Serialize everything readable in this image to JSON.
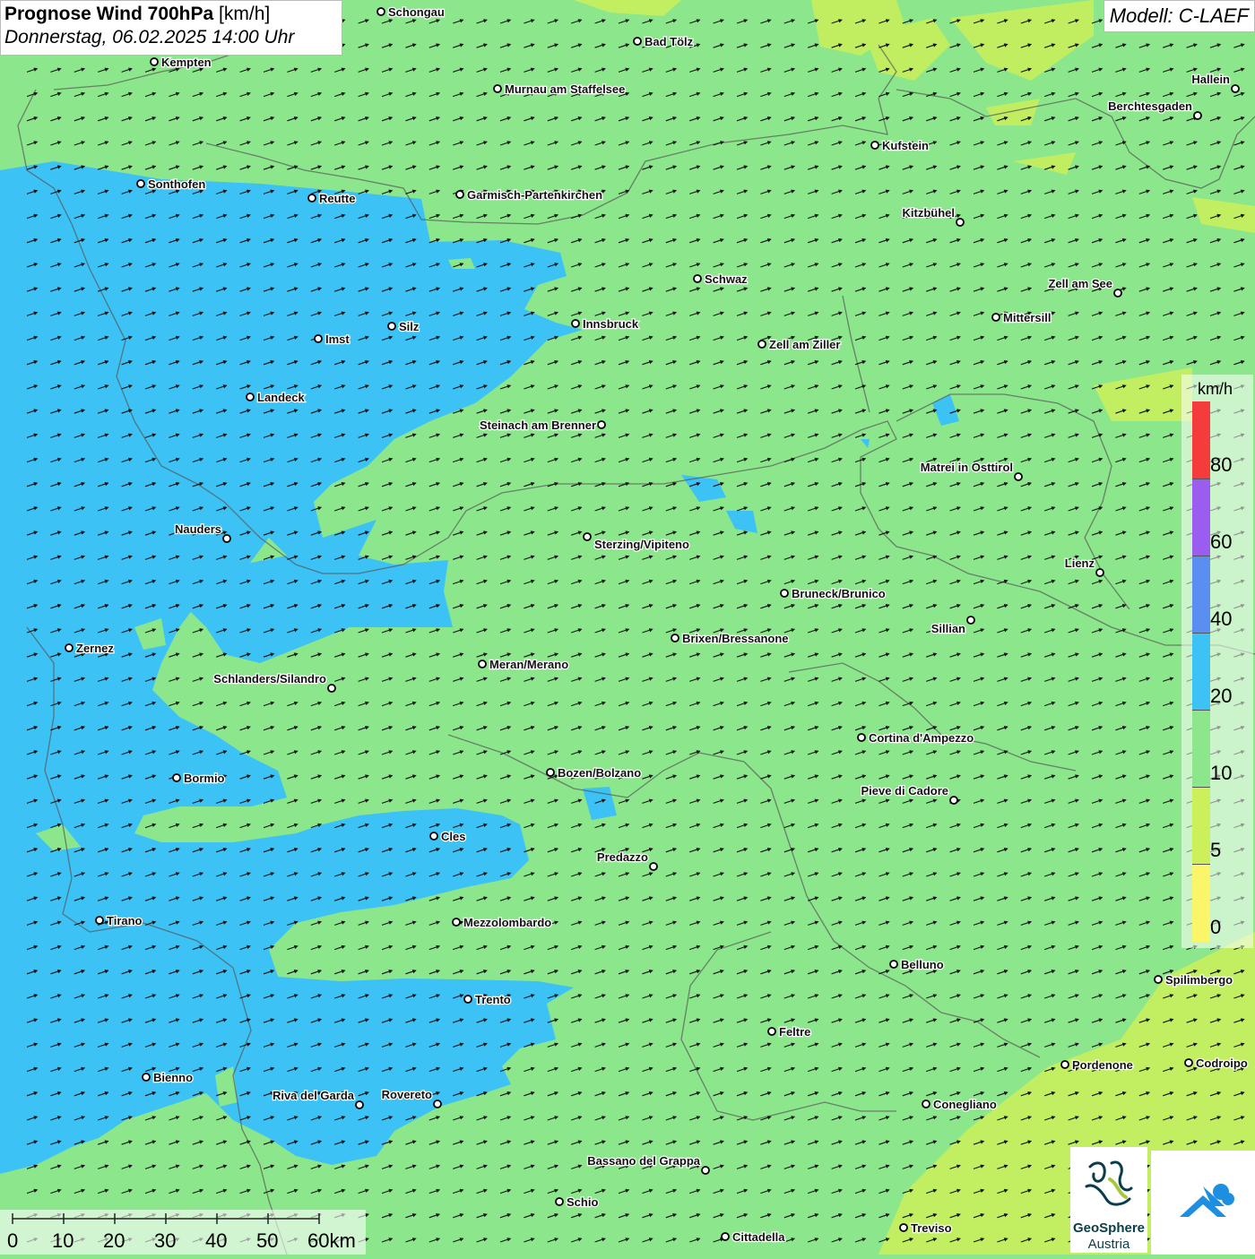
{
  "header": {
    "title_main": "Prognose Wind 700hPa",
    "title_unit": "[km/h]",
    "datetime": "Donnerstag, 06.02.2025 14:00 Uhr",
    "model": "Modell: C-LAEF"
  },
  "legend": {
    "unit": "km/h",
    "classes": [
      {
        "label": "80",
        "color": "#f53c3c"
      },
      {
        "label": "60",
        "color": "#9b5cf0"
      },
      {
        "label": "40",
        "color": "#5a8ef0"
      },
      {
        "label": "20",
        "color": "#3cc2f5"
      },
      {
        "label": "10",
        "color": "#8ce68c"
      },
      {
        "label": "5",
        "color": "#cbf05a"
      },
      {
        "label": "0",
        "color": "#fbf56a"
      }
    ]
  },
  "scale_bar": {
    "labels": [
      "0",
      "10",
      "20",
      "30",
      "40",
      "50",
      "60km"
    ]
  },
  "cities": [
    {
      "name": "Schongau",
      "id": "schongau"
    },
    {
      "name": "Bad Tölz",
      "id": "bad-toelz"
    },
    {
      "name": "Kempten",
      "id": "kempten"
    },
    {
      "name": "Murnau am Staffelsee",
      "id": "murnau"
    },
    {
      "name": "Hallein",
      "id": "hallein"
    },
    {
      "name": "Berchtesgaden",
      "id": "berchtesgaden"
    },
    {
      "name": "Kufstein",
      "id": "kufstein"
    },
    {
      "name": "Sonthofen",
      "id": "sonthofen"
    },
    {
      "name": "Reutte",
      "id": "reutte"
    },
    {
      "name": "Garmisch-Partenkirchen",
      "id": "garmisch"
    },
    {
      "name": "Kitzbühel",
      "id": "kitzbuehel"
    },
    {
      "name": "Schwaz",
      "id": "schwaz"
    },
    {
      "name": "Zell am See",
      "id": "zell-am-see"
    },
    {
      "name": "Innsbruck",
      "id": "innsbruck"
    },
    {
      "name": "Mittersill",
      "id": "mittersill"
    },
    {
      "name": "Silz",
      "id": "silz"
    },
    {
      "name": "Imst",
      "id": "imst"
    },
    {
      "name": "Zell am Ziller",
      "id": "zell-am-ziller"
    },
    {
      "name": "Landeck",
      "id": "landeck"
    },
    {
      "name": "Steinach am Brenner",
      "id": "steinach"
    },
    {
      "name": "Matrei in Osttirol",
      "id": "matrei"
    },
    {
      "name": "Nauders",
      "id": "nauders"
    },
    {
      "name": "Sterzing/Vipiteno",
      "id": "sterzing"
    },
    {
      "name": "Lienz",
      "id": "lienz"
    },
    {
      "name": "Bruneck/Brunico",
      "id": "bruneck"
    },
    {
      "name": "Sillian",
      "id": "sillian"
    },
    {
      "name": "Zernez",
      "id": "zernez"
    },
    {
      "name": "Brixen/Bressanone",
      "id": "brixen"
    },
    {
      "name": "Meran/Merano",
      "id": "meran"
    },
    {
      "name": "Schlanders/Silandro",
      "id": "schlanders"
    },
    {
      "name": "Cortina d'Ampezzo",
      "id": "cortina"
    },
    {
      "name": "Bozen/Bolzano",
      "id": "bozen"
    },
    {
      "name": "Bormio",
      "id": "bormio"
    },
    {
      "name": "Pieve di Cadore",
      "id": "pieve"
    },
    {
      "name": "Cles",
      "id": "cles"
    },
    {
      "name": "Predazzo",
      "id": "predazzo"
    },
    {
      "name": "Tirano",
      "id": "tirano"
    },
    {
      "name": "Mezzolombardo",
      "id": "mezzolombardo"
    },
    {
      "name": "Belluno",
      "id": "belluno"
    },
    {
      "name": "Spilimbergo",
      "id": "spilimbergo"
    },
    {
      "name": "Trento",
      "id": "trento"
    },
    {
      "name": "Feltre",
      "id": "feltre"
    },
    {
      "name": "Pordenone",
      "id": "pordenone"
    },
    {
      "name": "Codroipo",
      "id": "codroipo"
    },
    {
      "name": "Bienno",
      "id": "bienno"
    },
    {
      "name": "Riva del Garda",
      "id": "riva"
    },
    {
      "name": "Rovereto",
      "id": "rovereto"
    },
    {
      "name": "Conegliano",
      "id": "conegliano"
    },
    {
      "name": "Bassano del Grappa",
      "id": "bassano"
    },
    {
      "name": "Schio",
      "id": "schio"
    },
    {
      "name": "Treviso",
      "id": "treviso"
    },
    {
      "name": "Cittadella",
      "id": "cittadella"
    }
  ],
  "logos": {
    "geosphere_line1": "GeoSphere",
    "geosphere_line2": "Austria"
  }
}
